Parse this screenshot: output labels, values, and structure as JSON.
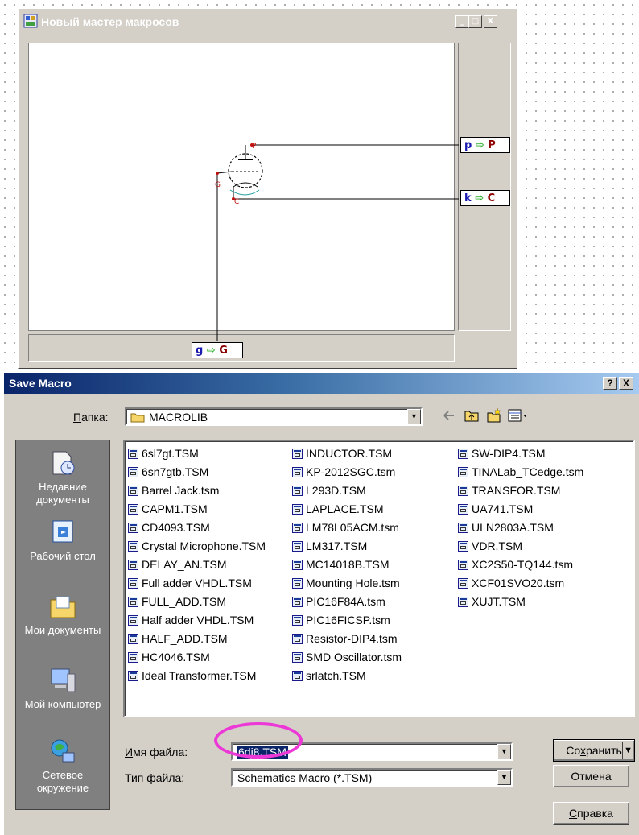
{
  "wizard": {
    "title": "Новый мастер макросов",
    "caption_buttons": [
      "_",
      "□",
      "X"
    ],
    "pins": {
      "p": {
        "left": "p",
        "arrow": "⇨",
        "right": "P"
      },
      "k": {
        "left": "k",
        "arrow": "⇨",
        "right": "C"
      },
      "g": {
        "left": "g",
        "arrow": "⇨",
        "right": "G"
      }
    },
    "tube_labels": {
      "plate": "P",
      "grid": "G",
      "cathode": "C"
    }
  },
  "dialog": {
    "title": "Save Macro",
    "help_btn": "?",
    "close_btn": "X",
    "folder_label_u": "П",
    "folder_label_rest": "апка:",
    "folder_value": "MACROLIB",
    "places": [
      {
        "label": "Недавние документы",
        "icon": "recent-documents-icon"
      },
      {
        "label": "Рабочий стол",
        "icon": "desktop-icon"
      },
      {
        "label": "Мои документы",
        "icon": "my-documents-icon"
      },
      {
        "label": "Мой компьютер",
        "icon": "my-computer-icon"
      },
      {
        "label": "Сетевое окружение",
        "icon": "network-icon"
      }
    ],
    "files_col1": [
      "6sl7gt.TSM",
      "6sn7gtb.TSM",
      "Barrel Jack.tsm",
      "CAPM1.TSM",
      "CD4093.TSM",
      "Crystal Microphone.TSM",
      "DELAY_AN.TSM",
      "Full adder VHDL.TSM",
      "FULL_ADD.TSM",
      "Half adder VHDL.TSM",
      "HALF_ADD.TSM",
      "HC4046.TSM",
      "Ideal Transformer.TSM"
    ],
    "files_col2": [
      "INDUCTOR.TSM",
      "KP-2012SGC.tsm",
      "L293D.TSM",
      "LAPLACE.TSM",
      "LM78L05ACM.tsm",
      "LM317.TSM",
      "MC14018B.TSM",
      "Mounting Hole.tsm",
      "PIC16F84A.tsm",
      "PIC16FICSP.tsm",
      "Resistor-DIP4.tsm",
      "SMD Oscillator.tsm",
      "srlatch.TSM"
    ],
    "files_col3": [
      "SW-DIP4.TSM",
      "TINALab_TCedge.tsm",
      "TRANSFOR.TSM",
      "UA741.TSM",
      "ULN2803A.TSM",
      "VDR.TSM",
      "XC2S50-TQ144.tsm",
      "XCF01SVO20.tsm",
      "XUJT.TSM"
    ],
    "filename_label_u": "И",
    "filename_label_rest": "мя файла:",
    "filename_value": "6dj8.TSM",
    "filetype_label_u": "Т",
    "filetype_label_rest": "ип файла:",
    "filetype_value": "Schematics Macro (*.TSM)",
    "save_btn_a": "Со",
    "save_btn_u": "х",
    "save_btn_b": "ранить",
    "cancel_btn": "Отмена",
    "help_btn_u": "С",
    "help_btn_rest": "правка"
  },
  "colors": {
    "highlight": "#ec38d6",
    "title_dark": "#0a246a",
    "pin_left": "#1a1ab0",
    "pin_arrow": "#2fb02f",
    "pin_right": "#8b0000"
  }
}
